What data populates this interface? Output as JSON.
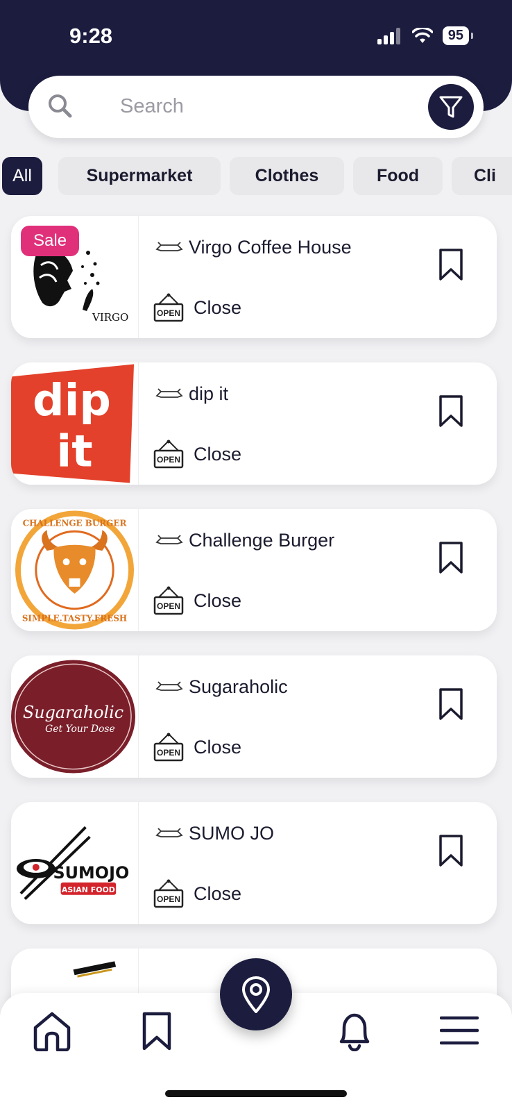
{
  "status_bar": {
    "time": "9:28",
    "battery": "95"
  },
  "search": {
    "placeholder": "Search"
  },
  "categories": [
    "All",
    "Supermarket",
    "Clothes",
    "Food",
    "Cli"
  ],
  "cards": [
    {
      "name": "Virgo Coffee House",
      "status": "Close",
      "badge": "Sale",
      "logo_text": "VIRGO"
    },
    {
      "name": "dip it",
      "status": "Close",
      "logo_text": "dip it"
    },
    {
      "name": "Challenge Burger",
      "status": "Close",
      "logo_text": "CHALLENGE BURGER",
      "logo_subtext": "SIMPLE.TASTY.FRESH"
    },
    {
      "name": "Sugaraholic",
      "status": "Close",
      "logo_text": "Sugaraholic",
      "logo_subtext": "Get Your Dose"
    },
    {
      "name": "SUMO JO",
      "status": "Close",
      "logo_text": "SUMOJO",
      "logo_subtext": "ASIAN FOOD"
    }
  ],
  "open_sign_text": "OPEN",
  "colors": {
    "primary": "#1c1c3f",
    "sale": "#e0307a",
    "background": "#f1f1f4"
  }
}
